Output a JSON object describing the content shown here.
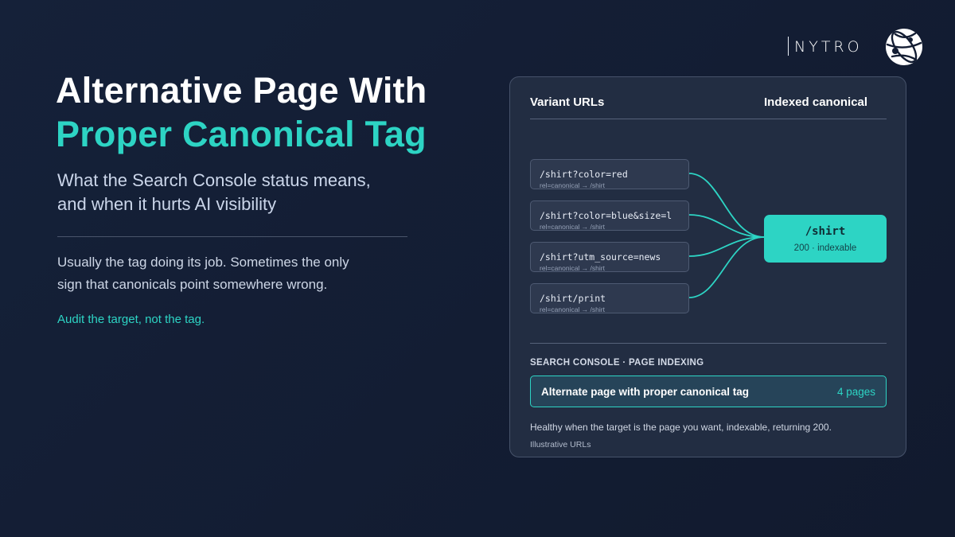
{
  "hero": {
    "title_line1": "Alternative Page With",
    "title_line2": "Proper Canonical Tag",
    "subtitle_line1": "What the Search Console status means,",
    "subtitle_line2": "and when it hurts AI visibility",
    "body_line1": "Usually the tag doing its job. Sometimes the only",
    "body_line2": "sign that canonicals point somewhere wrong.",
    "cta": "Audit the target, not the tag."
  },
  "brand": {
    "name": "NYTRO",
    "icon": "globe-icon"
  },
  "panel": {
    "left_heading": "Variant URLs",
    "right_heading": "Indexed canonical",
    "variants": [
      {
        "path": "/shirt?color=red",
        "rel": "rel=canonical → /shirt"
      },
      {
        "path": "/shirt?color=blue&size=l",
        "rel": "rel=canonical → /shirt"
      },
      {
        "path": "/shirt?utm_source=news",
        "rel": "rel=canonical → /shirt"
      },
      {
        "path": "/shirt/print",
        "rel": "rel=canonical → /shirt"
      }
    ],
    "canonical": {
      "path": "/shirt",
      "meta": "200 · indexable"
    },
    "section_label": "SEARCH CONSOLE · PAGE INDEXING",
    "status": {
      "name": "Alternate page with proper canonical tag",
      "count": "4 pages"
    },
    "note": "Healthy when the target is the page you want, indexable, returning 200.",
    "footnote": "Illustrative URLs"
  },
  "colors": {
    "accent": "#2dd4c4",
    "background": "#131d33",
    "panel": "#222d42"
  }
}
